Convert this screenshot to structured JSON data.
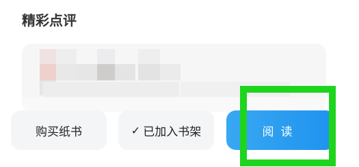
{
  "section": {
    "title": "精彩点评"
  },
  "review_card": {
    "content": ""
  },
  "actions": {
    "buy_print": "购买纸书",
    "shelf_check": "✓",
    "shelf_label": "已加入书架",
    "read": "阅读"
  },
  "colors": {
    "read_button": "#1e93ef",
    "highlight": "#1ed41e",
    "secondary_button": "#f4f5f7"
  }
}
